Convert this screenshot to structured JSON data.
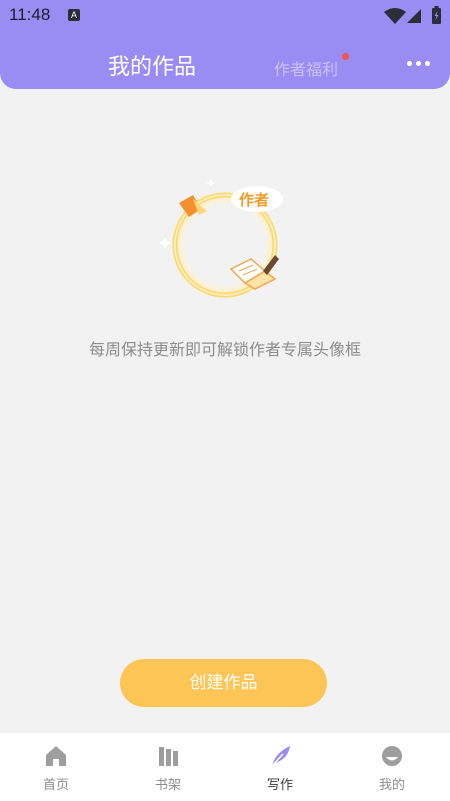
{
  "status_bar": {
    "time": "11:48",
    "app_icon_letter": "A"
  },
  "header": {
    "title": "我的作品",
    "welfare_label": "作者福利",
    "badge_color": "#f0544c"
  },
  "empty_state": {
    "badge_text": "作者",
    "hint": "每周保持更新即可解锁作者专属头像框"
  },
  "create_button": {
    "label": "创建作品"
  },
  "bottom_nav": {
    "items": [
      {
        "label": "首页",
        "icon": "home-icon"
      },
      {
        "label": "书架",
        "icon": "bookshelf-icon"
      },
      {
        "label": "写作",
        "icon": "feather-pen-icon",
        "active": true
      },
      {
        "label": "我的",
        "icon": "profile-icon"
      }
    ]
  },
  "colors": {
    "header_bg": "#9b8cf3",
    "accent_button": "#fdc555",
    "active_nav": "#9b8cf3",
    "page_bg": "#f2f2f2"
  }
}
